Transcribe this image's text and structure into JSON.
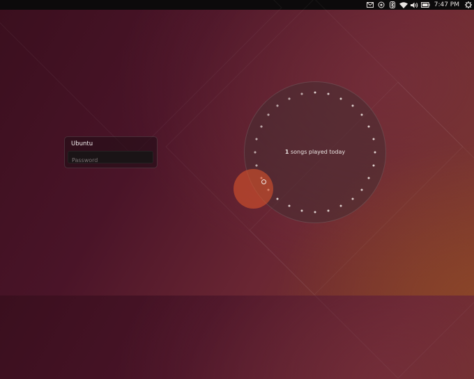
{
  "panel": {
    "indicators": [
      {
        "icon": "mail-icon"
      },
      {
        "icon": "sound-menu-icon"
      },
      {
        "icon": "bluetooth-icon"
      },
      {
        "icon": "wifi-icon"
      },
      {
        "icon": "volume-icon"
      },
      {
        "icon": "battery-icon"
      }
    ],
    "clock": "7:47 PM",
    "power_icon": "power-icon"
  },
  "login": {
    "username": "Ubuntu",
    "password_placeholder": "Password"
  },
  "info_circle": {
    "count": "1",
    "text": "songs played today",
    "dots_total": 28,
    "highlight_color": "#d6522c"
  }
}
